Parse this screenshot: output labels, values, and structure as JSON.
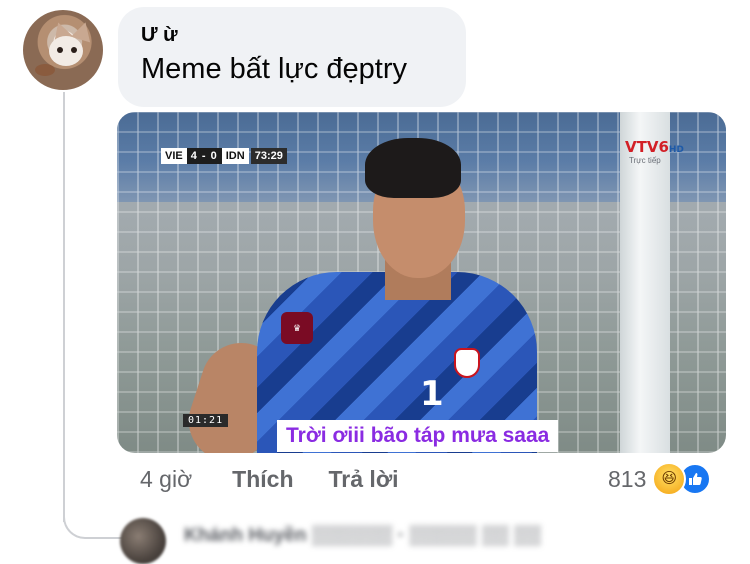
{
  "comment": {
    "author": "Ư ừ",
    "text": "Meme bất lực đẹptry",
    "media": {
      "scoreboard": {
        "home": "VIE",
        "score": "4 - 0",
        "away": "IDN",
        "time": "73:29"
      },
      "channel": "VTV6",
      "channel_hd": "HD",
      "channel_sub": "Trực tiếp",
      "clip_timer": "01:21",
      "jersey_number": "1",
      "caption": "Trời ơiii bão táp mưa saaa"
    },
    "timestamp": "4 giờ",
    "like_label": "Thích",
    "reply_label": "Trả lời",
    "reaction_count": "813",
    "reaction_icons": [
      "haha-icon",
      "like-thumb-icon"
    ]
  },
  "next_comment": {
    "preview": "Khánh Huyền ▒▒▒▒▒▒ · ▒▒▒▒▒ ▒▒ ▒▒"
  },
  "colors": {
    "bubble_bg": "#f0f2f5",
    "caption_text": "#8a2be2",
    "like_blue": "#1877f2",
    "muted": "#65676b"
  }
}
